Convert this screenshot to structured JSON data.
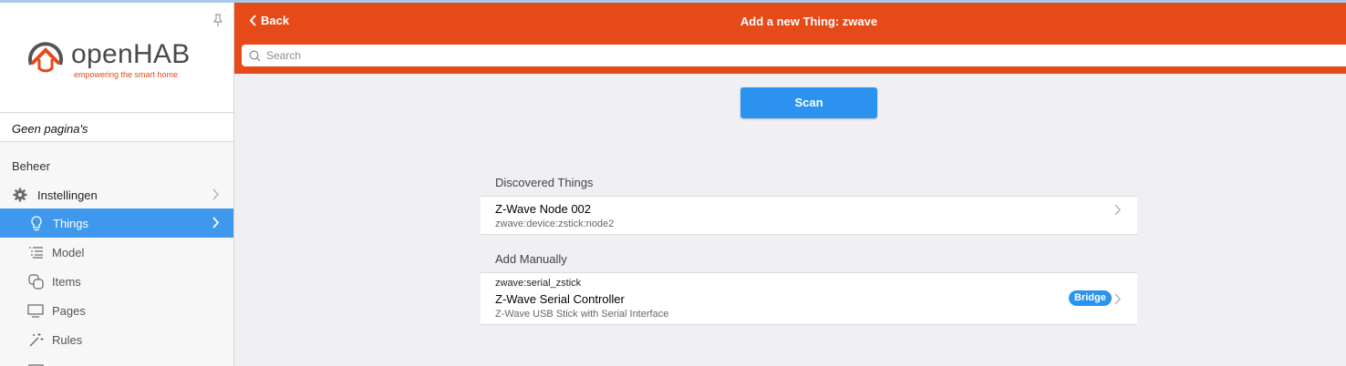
{
  "app": {
    "logo_text": "openHAB",
    "tagline": "empowering the smart home"
  },
  "sidebar": {
    "pages_label": "Geen pagina's",
    "section": "Beheer",
    "items": [
      {
        "label": "Instellingen",
        "icon": "gear-icon"
      },
      {
        "label": "Things",
        "icon": "lightbulb-icon",
        "active": true
      },
      {
        "label": "Model",
        "icon": "list-icon"
      },
      {
        "label": "Items",
        "icon": "squares-icon"
      },
      {
        "label": "Pages",
        "icon": "monitor-icon"
      },
      {
        "label": "Rules",
        "icon": "wand-icon"
      }
    ]
  },
  "header": {
    "back_label": "Back",
    "title": "Add a new Thing: zwave",
    "search_placeholder": "Search"
  },
  "main": {
    "scan_label": "Scan",
    "discovered_title": "Discovered Things",
    "discovered": [
      {
        "name": "Z-Wave Node 002",
        "uid": "zwave:device:zstick:node2"
      }
    ],
    "manual_title": "Add Manually",
    "manual": [
      {
        "id": "zwave:serial_zstick",
        "name": "Z-Wave Serial Controller",
        "description": "Z-Wave USB Stick with Serial Interface",
        "badge": "Bridge"
      }
    ]
  },
  "colors": {
    "header": "#e64a19",
    "accent": "#3f98ec",
    "button": "#2b93ef"
  }
}
